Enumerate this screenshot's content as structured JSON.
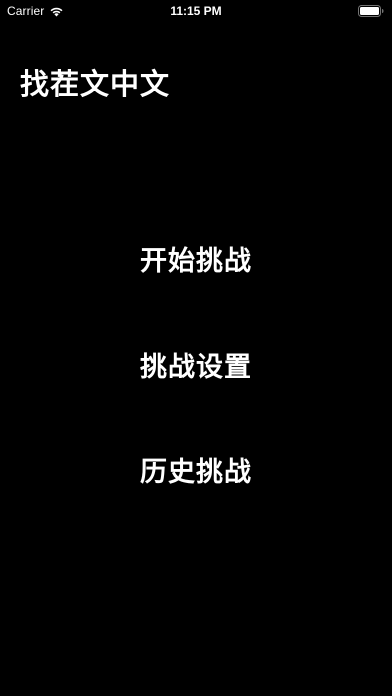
{
  "status_bar": {
    "carrier": "Carrier",
    "time": "11:15 PM",
    "wifi_icon": "wifi-icon",
    "battery_icon": "battery-icon"
  },
  "app": {
    "title": "找茬文中文",
    "background_color": "#000000",
    "text_color": "#ffffff"
  },
  "menu": {
    "start_label": "开始挑战",
    "settings_label": "挑战设置",
    "history_label": "历史挑战"
  }
}
